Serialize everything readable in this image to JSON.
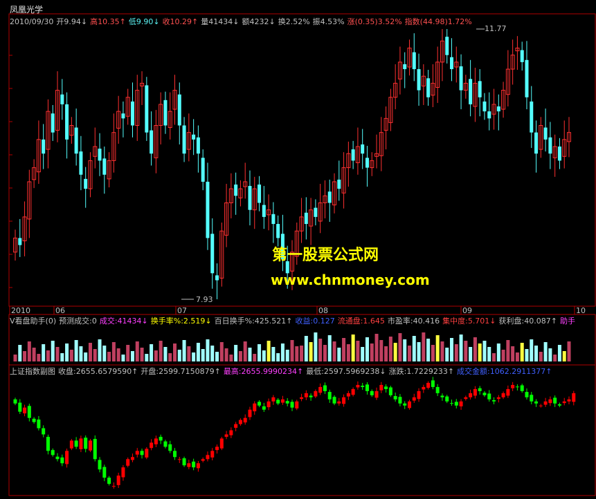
{
  "app": {
    "title": "凤凰光学"
  },
  "main_header": [
    {
      "text": "2010/09/30",
      "color": "#c0c0c0"
    },
    {
      "text": "开9.94↓",
      "color": "#c0c0c0"
    },
    {
      "text": "高10.35↑",
      "color": "#ff5050"
    },
    {
      "text": "低9.90↓",
      "color": "#5cf5f5"
    },
    {
      "text": "收10.29↑",
      "color": "#ff5050"
    },
    {
      "text": "量41434↓",
      "color": "#c0c0c0"
    },
    {
      "text": "额4232↓",
      "color": "#c0c0c0"
    },
    {
      "text": "换2.52%",
      "color": "#c0c0c0"
    },
    {
      "text": "振4.53%",
      "color": "#c0c0c0"
    },
    {
      "text": "涨(0.35)3.52%",
      "color": "#ff5050"
    },
    {
      "text": "指数(44.98)1.72%",
      "color": "#ff5050"
    }
  ],
  "price_labels": {
    "high": "11.77",
    "low": "7.93"
  },
  "x_axis_labels": [
    "2010",
    "06",
    "07",
    "08",
    "09",
    "10"
  ],
  "volume_header": [
    {
      "text": "V看盘助手(0)",
      "color": "#c0c0c0"
    },
    {
      "text": "预测成交:0",
      "color": "#c0c0c0"
    },
    {
      "text": "成交:41434↓",
      "color": "#ff40ff"
    },
    {
      "text": "换手率%:2.519↓",
      "color": "#ffff00"
    },
    {
      "text": "百日换手%:425.521↑",
      "color": "#c0c0c0"
    },
    {
      "text": "收益:0.127",
      "color": "#4060ff"
    },
    {
      "text": "流通盘:1.645",
      "color": "#ff4040"
    },
    {
      "text": "市盈率:40.416",
      "color": "#c0c0c0"
    },
    {
      "text": "集中度:5.701↓",
      "color": "#ff4040"
    },
    {
      "text": "获利盘:40.087↑",
      "color": "#c0c0c0"
    },
    {
      "text": "助手",
      "color": "#ff40ff"
    }
  ],
  "index_header": [
    {
      "text": "上证指数副图",
      "color": "#c0c0c0"
    },
    {
      "text": "收盘:2655.6579590↑",
      "color": "#c0c0c0"
    },
    {
      "text": "开盘:2599.7150879↑",
      "color": "#c0c0c0"
    },
    {
      "text": "最高:2655.9990234↑",
      "color": "#ff40ff"
    },
    {
      "text": "最低:2597.5969238↓",
      "color": "#c0c0c0"
    },
    {
      "text": "涨跌:1.7229233↑",
      "color": "#c0c0c0"
    },
    {
      "text": "成交金额:1062.2911377↑",
      "color": "#4060ff"
    }
  ],
  "watermark": {
    "line1": "第一股票公式网",
    "line2": "www.chnmoney.com"
  },
  "colors": {
    "up": "#ff3030",
    "down": "#54ffff",
    "frame": "#b00000",
    "idx_up": "#ff0000",
    "idx_down": "#00ff00"
  },
  "chart_data": {
    "type": "candlestick",
    "stock_close": [
      8.8,
      8.7,
      9.1,
      9.6,
      9.8,
      10.2,
      10.0,
      10.6,
      10.3,
      10.9,
      10.7,
      10.2,
      10.4,
      10.0,
      9.7,
      9.5,
      9.9,
      10.1,
      9.9,
      9.7,
      9.9,
      10.3,
      10.6,
      10.5,
      10.8,
      10.4,
      10.9,
      11.0,
      10.3,
      10.0,
      10.4,
      10.7,
      10.4,
      10.6,
      10.9,
      10.4,
      10.0,
      10.3,
      10.2,
      10.0,
      9.6,
      8.8,
      8.3,
      8.2,
      8.9,
      9.3,
      9.5,
      9.4,
      9.5,
      9.6,
      9.2,
      9.5,
      9.3,
      9.1,
      9.2,
      9.0,
      8.8,
      8.5,
      8.3,
      8.6,
      8.9,
      9.1,
      9.0,
      9.2,
      9.1,
      9.3,
      9.4,
      9.3,
      9.6,
      9.5,
      9.8,
      10.0,
      9.9,
      10.1,
      10.0,
      9.8,
      9.9,
      10.0,
      10.3,
      10.5,
      10.8,
      11.0,
      11.3,
      11.2,
      11.5,
      11.2,
      10.9,
      11.1,
      10.8,
      11.0,
      11.3,
      11.6,
      11.4,
      11.2,
      11.3,
      10.9,
      11.0,
      10.7,
      11.0,
      10.8,
      10.6,
      10.5,
      10.7,
      10.6,
      10.9,
      11.2,
      11.4,
      11.5,
      11.3,
      10.8,
      10.3,
      10.0,
      10.4,
      10.2,
      10.0,
      10.1,
      9.9,
      10.2,
      10.3
    ],
    "index_close": [
      2870,
      2830,
      2850,
      2800,
      2780,
      2750,
      2720,
      2640,
      2620,
      2600,
      2580,
      2640,
      2690,
      2660,
      2700,
      2650,
      2690,
      2600,
      2550,
      2510,
      2480,
      2470,
      2520,
      2560,
      2600,
      2610,
      2640,
      2620,
      2650,
      2680,
      2700,
      2690,
      2660,
      2640,
      2610,
      2600,
      2570,
      2580,
      2560,
      2580,
      2600,
      2620,
      2640,
      2660,
      2700,
      2720,
      2740,
      2770,
      2790,
      2800,
      2840,
      2870,
      2860,
      2840,
      2880,
      2900,
      2870,
      2890,
      2870,
      2850,
      2880,
      2900,
      2920,
      2900,
      2930,
      2950,
      2930,
      2890,
      2870,
      2880,
      2900,
      2920,
      2940,
      2960,
      2950,
      2930,
      2910,
      2930,
      2960,
      2940,
      2910,
      2890,
      2870,
      2860,
      2880,
      2900,
      2930,
      2950,
      2970,
      2950,
      2920,
      2900,
      2880,
      2870,
      2860,
      2880,
      2900,
      2920,
      2940,
      2930,
      2910,
      2890,
      2880,
      2900,
      2920,
      2940,
      2960,
      2950,
      2930,
      2900,
      2880,
      2870,
      2860,
      2880,
      2890,
      2870,
      2860,
      2880,
      2890,
      2920
    ]
  }
}
